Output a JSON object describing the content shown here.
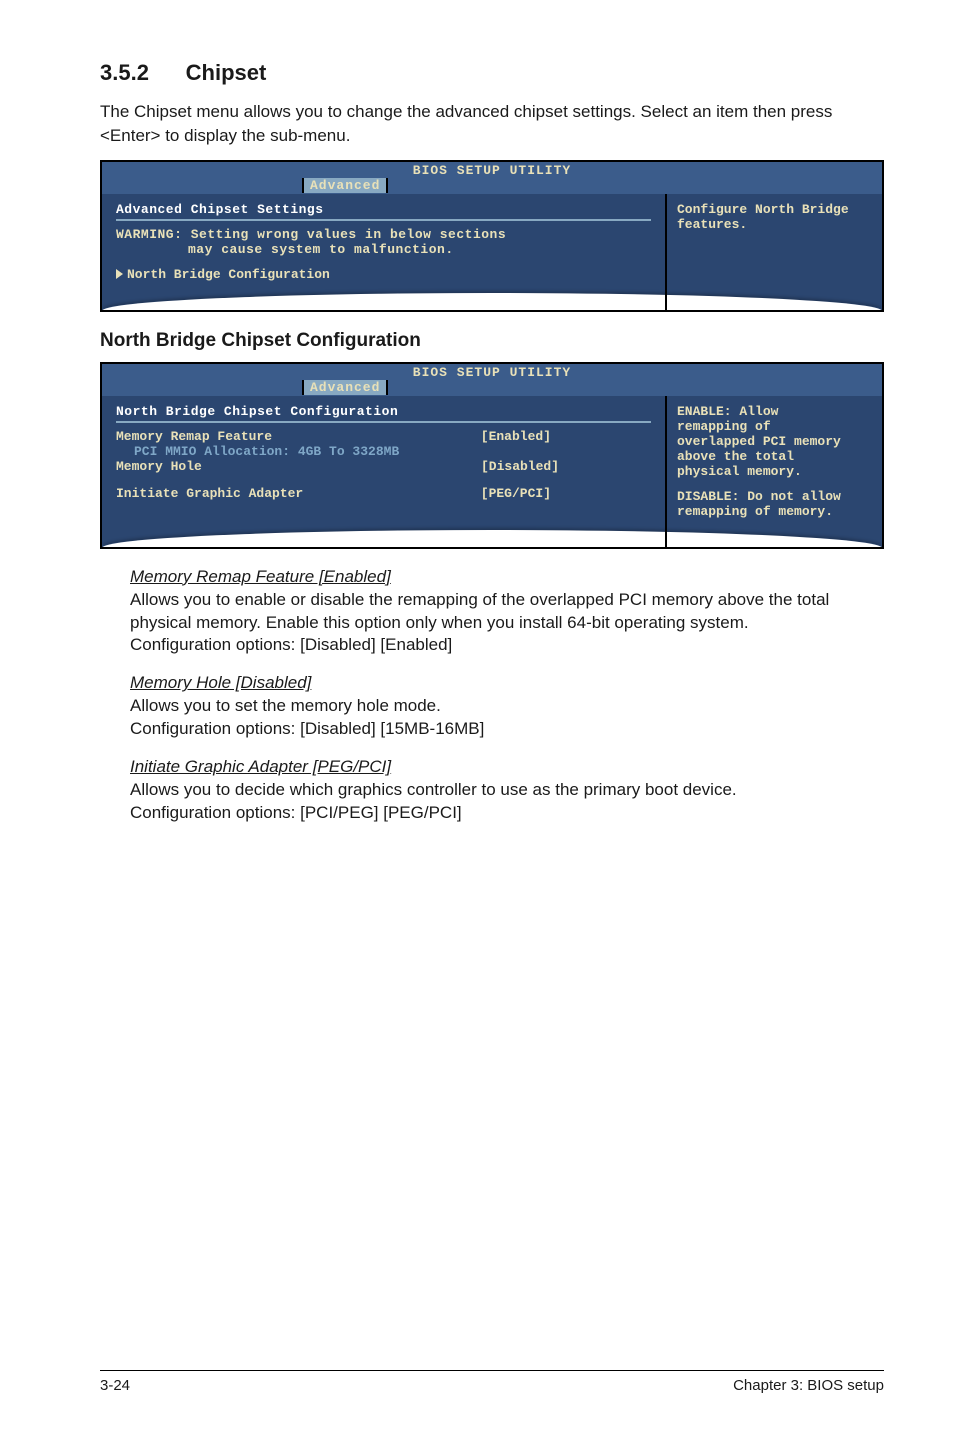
{
  "section": {
    "number": "3.5.2",
    "title": "Chipset",
    "intro": "The Chipset menu allows you to change the advanced chipset settings. Select an item then press <Enter> to display the sub-menu."
  },
  "bios1": {
    "header": "BIOS SETUP UTILITY",
    "tab": "Advanced",
    "left_title": "Advanced Chipset Settings",
    "warning_l1": "WARMING: Setting wrong values in below sections",
    "warning_l2": "may cause system to malfunction.",
    "link": "North Bridge Configuration",
    "right_l1": "Configure North Bridge",
    "right_l2": "features."
  },
  "subheading": "North Bridge Chipset Configuration",
  "bios2": {
    "header": "BIOS SETUP UTILITY",
    "tab": "Advanced",
    "left_title": "North Bridge Chipset Configuration",
    "row1_label": "Memory Remap Feature",
    "row1_value": "[Enabled]",
    "row_sub": "PCI MMIO Allocation: 4GB To 3328MB",
    "row2_label": "Memory Hole",
    "row2_value": "[Disabled]",
    "row3_label": "Initiate Graphic Adapter",
    "row3_value": "[PEG/PCI]",
    "right_l1": "ENABLE: Allow",
    "right_l2": "remapping of",
    "right_l3": "overlapped PCI memory",
    "right_l4": "above the total",
    "right_l5": "physical memory.",
    "right_l6": "DISABLE: Do not allow",
    "right_l7": "remapping of memory."
  },
  "items": {
    "memremap": {
      "title": "Memory Remap Feature [Enabled]",
      "body1": "Allows you to enable or disable the remapping of the overlapped PCI memory above the total physical memory. Enable this option only when you install 64-bit operating system.",
      "body2": "Configuration options: [Disabled] [Enabled]"
    },
    "memhole": {
      "title": "Memory Hole [Disabled]",
      "body1": "Allows you to set the memory hole mode.",
      "body2": "Configuration options: [Disabled] [15MB-16MB]"
    },
    "iga": {
      "title": "Initiate Graphic Adapter [PEG/PCI]",
      "body1": "Allows you to decide which graphics controller to use as the primary boot device.",
      "body2": "Configuration options: [PCI/PEG] [PEG/PCI]"
    }
  },
  "footer": {
    "left": "3-24",
    "right": "Chapter 3: BIOS setup"
  }
}
